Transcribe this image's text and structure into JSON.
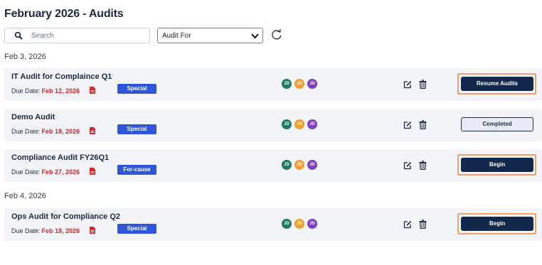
{
  "page": {
    "title": "February 2026 - Audits"
  },
  "search": {
    "placeholder": "Search",
    "value": "",
    "icon": "search-icon"
  },
  "filter": {
    "selected": "Audit For",
    "icon": "chevron-down-icon"
  },
  "refresh": {
    "icon": "refresh-icon"
  },
  "colors": {
    "due_date": "#d8262a",
    "badge": "#2d57d8",
    "action_button": "#13284d",
    "highlight_frame": "#f0a06b",
    "avatar_colors": [
      "#1f7a62",
      "#f0a030",
      "#7b3fbf"
    ]
  },
  "groups": [
    {
      "date": "Feb 3, 2026",
      "audits": [
        {
          "name": "IT Audit for Complaince Q1",
          "due_label": "Due Date:",
          "due_date": "Feb 12, 2026",
          "badge": "Special",
          "avatars": [
            "JD",
            "JD",
            "JD"
          ],
          "action": "Resume Audits",
          "status": "action"
        },
        {
          "name": "Demo Audit",
          "due_label": "Due Date:",
          "due_date": "Feb 18, 2026",
          "badge": "Special",
          "avatars": [
            "JD",
            "JD",
            "JD"
          ],
          "action": "Completed",
          "status": "completed"
        },
        {
          "name": "Compliance Audit FY26Q1",
          "due_label": "Due Date:",
          "due_date": "Feb 27, 2026",
          "badge": "For-cause",
          "avatars": [
            "JD",
            "JD",
            "JD"
          ],
          "action": "Begin",
          "status": "action"
        }
      ]
    },
    {
      "date": "Feb 4, 2026",
      "audits": [
        {
          "name": "Ops Audit for Compliance Q2",
          "due_label": "Due Date:",
          "due_date": "Feb 18, 2026",
          "badge": "Special",
          "avatars": [
            "JD",
            "JD",
            "JD"
          ],
          "action": "Begin",
          "status": "action"
        }
      ]
    }
  ]
}
